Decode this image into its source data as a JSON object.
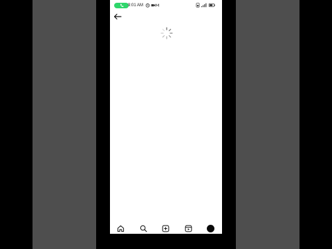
{
  "status_bar": {
    "time": "9:01 AM",
    "icons": [
      "call-pill-icon",
      "alarm-icon",
      "video-call-icon",
      "notification-icon",
      "sim-icon",
      "signal-icon",
      "battery-icon"
    ],
    "call_color": "#2fd66b"
  },
  "header": {
    "back_icon": "arrow-left-icon"
  },
  "content": {
    "state": "loading",
    "spinner_icon": "loading-spinner-icon"
  },
  "bottom_nav": {
    "items": [
      "home-icon",
      "search-icon",
      "create-post-icon",
      "reels-icon",
      "profile-avatar"
    ]
  },
  "colors": {
    "background": "#ffffff",
    "side_panels": "#4e4e4e",
    "frame": "#000000"
  }
}
